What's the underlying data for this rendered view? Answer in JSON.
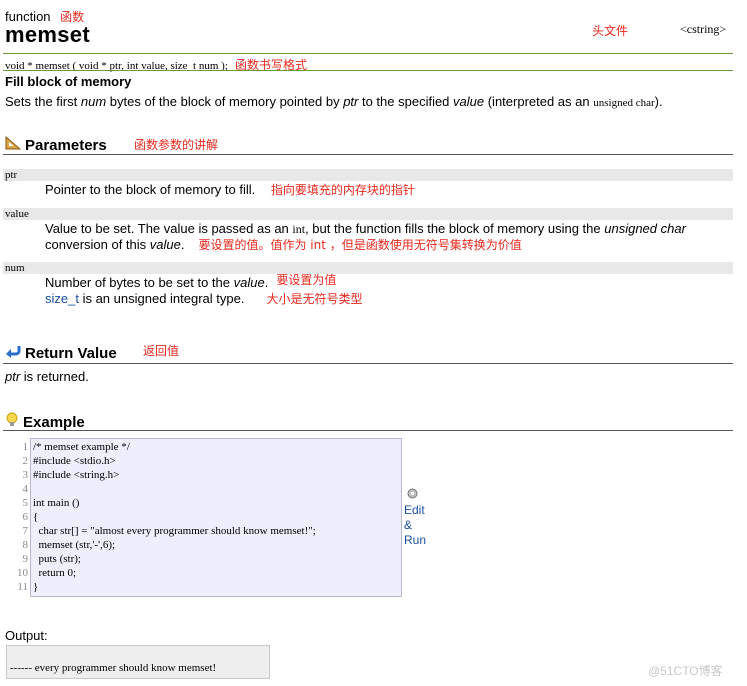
{
  "header": {
    "kind": "function",
    "kind_note": "函数",
    "title": "memset",
    "file_note": "头文件",
    "file_name": "<cstring>"
  },
  "prototype": {
    "code": "void * memset ( void * ptr, int value, size_t num );",
    "note": "函数书写格式"
  },
  "summary": {
    "title": "Fill block of memory",
    "desc_1": "Sets the first ",
    "desc_num": "num",
    "desc_2": " bytes of the block of memory pointed by ",
    "desc_ptr": "ptr",
    "desc_3": " to the specified ",
    "desc_value": "value",
    "desc_4": " (interpreted as an ",
    "desc_code": "unsigned char",
    "desc_5": ")."
  },
  "parameters": {
    "title": "Parameters",
    "note": "函数参数的讲解",
    "ptr": {
      "name": "ptr",
      "text": "Pointer to the block of memory to fill.",
      "note": "指向要填充的内存块的指针"
    },
    "value": {
      "name": "value",
      "line1_a": "Value to be set. The value is passed as an ",
      "line1_code": "int",
      "line1_b": ", but the function fills the block of memory using the ",
      "line1_i": "unsigned char",
      "line2_a": "conversion of this ",
      "line2_i": "value",
      "line2_b": ".",
      "note": "要设置的值。值作为 int ，但是函数使用无符号集转换为价值"
    },
    "num": {
      "name": "num",
      "line1_a": "Number of bytes to be set to the ",
      "line1_i": "value",
      "line1_b": ".",
      "note1": "要设置为值",
      "line2_code": "size_t",
      "line2_b": " is an unsigned integral type.",
      "note2": "大小是无符号类型"
    }
  },
  "return_value": {
    "title": "Return Value",
    "note": "返回值",
    "text_i": "ptr",
    "text_b": " is returned."
  },
  "example": {
    "title": "Example",
    "line_numbers": [
      "1",
      "2",
      "3",
      "4",
      "5",
      "6",
      "7",
      "8",
      "9",
      "10",
      "11"
    ],
    "code_lines": [
      "/* memset example */",
      "#include <stdio.h>",
      "#include <string.h>",
      "",
      "int main ()",
      "{",
      "  char str[] = \"almost every programmer should know memset!\";",
      "  memset (str,'-',6);",
      "  puts (str);",
      "  return 0;",
      "}"
    ],
    "edit_run": [
      "Edit",
      "&",
      "Run"
    ]
  },
  "output": {
    "label": "Output:",
    "text": "------ every programmer should know memset!"
  },
  "watermark": "@51CTO博客",
  "colors": {
    "annotation_red": "#e8281e",
    "link_blue": "#1a4fa0",
    "rule_green": "#6a9a3a",
    "code_bg": "#eeeefc"
  }
}
